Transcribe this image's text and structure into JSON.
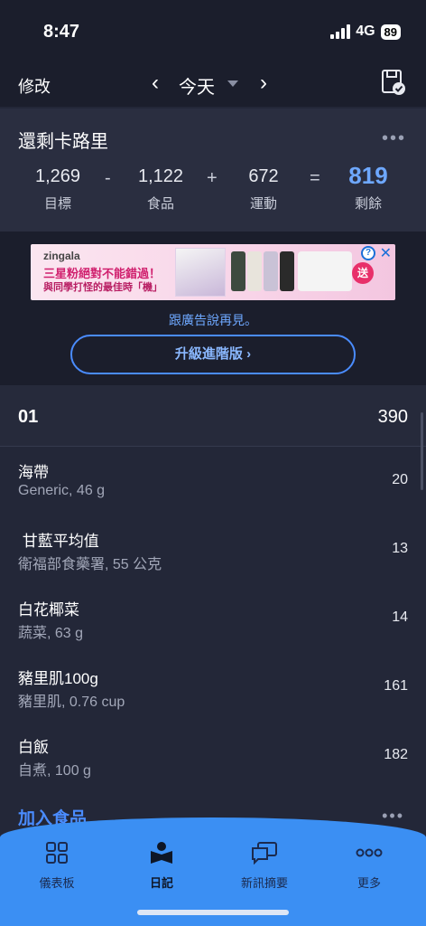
{
  "status": {
    "time": "8:47",
    "network": "4G",
    "battery": "89"
  },
  "nav": {
    "edit_label": "修改",
    "date_label": "今天"
  },
  "calories": {
    "title": "還剩卡路里",
    "goal": {
      "value": "1,269",
      "label": "目標"
    },
    "food": {
      "value": "1,122",
      "label": "食品"
    },
    "exercise": {
      "value": "672",
      "label": "運動"
    },
    "remaining": {
      "value": "819",
      "label": "剩餘"
    },
    "ops": {
      "minus": "-",
      "plus": "+",
      "equals": "="
    }
  },
  "ad": {
    "brand": "zingala",
    "headline": "三星粉絕對不能錯過！",
    "subline": "與同學打怪的最佳時「機」",
    "gift_badge": "送",
    "remove_ads_text": "跟廣告說再見。",
    "upgrade_label": "升級進階版 ›"
  },
  "meal": {
    "name": "01",
    "total": "390",
    "items": [
      {
        "name": "海帶",
        "detail": "Generic, 46 g",
        "calories": "20"
      },
      {
        "name": " 甘藍平均值",
        "detail": "衛福部食藥署, 55 公克",
        "calories": "13"
      },
      {
        "name": "白花椰菜",
        "detail": "蔬菜, 63 g",
        "calories": "14"
      },
      {
        "name": "豬里肌100g",
        "detail": "豬里肌, 0.76 cup",
        "calories": "161"
      },
      {
        "name": "白飯",
        "detail": "自煮, 100 g",
        "calories": "182"
      }
    ],
    "add_food_label": "加入食品"
  },
  "tabs": [
    {
      "label": "儀表板",
      "icon": "dashboard-icon"
    },
    {
      "label": "日記",
      "icon": "diary-icon"
    },
    {
      "label": "新訊摘要",
      "icon": "newsfeed-icon"
    },
    {
      "label": "更多",
      "icon": "more-icon"
    }
  ],
  "colors": {
    "accent": "#3b8ff3",
    "remaining": "#6ea8ff",
    "background": "#232738"
  }
}
